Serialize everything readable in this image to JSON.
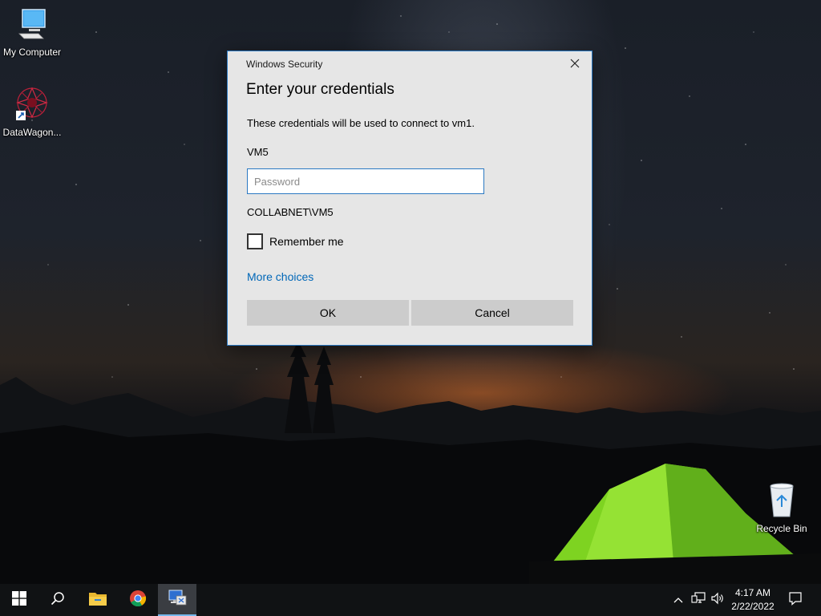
{
  "desktop": {
    "icons": [
      {
        "label": "My Computer",
        "icon": "monitor-icon"
      },
      {
        "label": "DataWagon...",
        "icon": "datawagon-icon"
      },
      {
        "label": "Recycle Bin",
        "icon": "recycle-bin-icon"
      }
    ]
  },
  "dialog": {
    "window_title": "Windows Security",
    "heading": "Enter your credentials",
    "description": "These credentials will be used to connect to vm1.",
    "username": "VM5",
    "password": {
      "placeholder": "Password",
      "value": ""
    },
    "domain_user": "COLLABNET\\VM5",
    "remember_label": "Remember me",
    "remember_checked": false,
    "more_choices": "More choices",
    "ok_label": "OK",
    "cancel_label": "Cancel",
    "accent_color": "#2b79c2",
    "link_color": "#0067b8"
  },
  "taskbar": {
    "items": [
      {
        "icon": "windows-start-icon"
      },
      {
        "icon": "search-icon"
      },
      {
        "icon": "file-explorer-icon"
      },
      {
        "icon": "chrome-icon"
      },
      {
        "icon": "remote-desktop-icon",
        "active": true
      }
    ],
    "tray": {
      "icons": [
        "chevron-up-icon",
        "network-icon",
        "volume-icon",
        "notification-icon"
      ],
      "time": "4:17 AM",
      "date": "2/22/2022"
    }
  }
}
